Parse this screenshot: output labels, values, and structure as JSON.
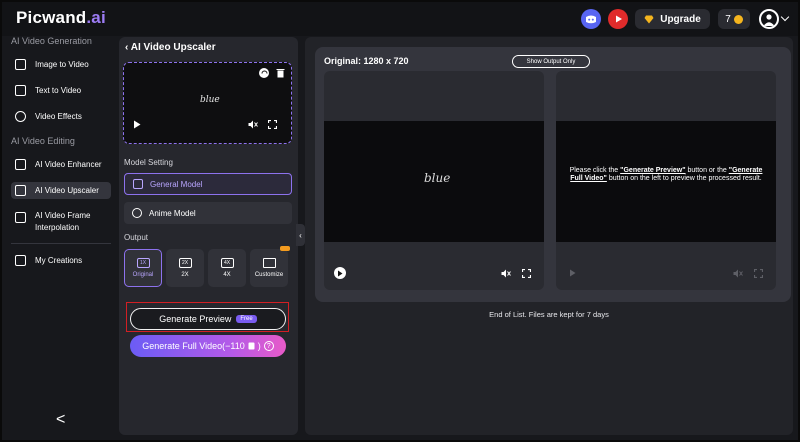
{
  "header": {
    "logo_text": "Picwand",
    "logo_suffix": ".ai",
    "upgrade_label": "Upgrade",
    "credits": "7",
    "icons": [
      "discord-icon",
      "youtube-icon",
      "diamond-icon",
      "coin-icon",
      "user-icon",
      "chevron-down-icon"
    ]
  },
  "sidebar": {
    "section1": "AI Video Generation",
    "section2": "AI Video Editing",
    "items": [
      {
        "label": "Image to Video",
        "icon": "image-icon"
      },
      {
        "label": "Text to Video",
        "icon": "text-icon"
      },
      {
        "label": "Video Effects",
        "icon": "effects-icon"
      },
      {
        "label": "AI Video Enhancer",
        "icon": "enhancer-icon"
      },
      {
        "label": "AI Video Upscaler",
        "icon": "upscaler-icon"
      },
      {
        "label": "AI Video Frame Interpolation",
        "icon": "interpolation-icon"
      },
      {
        "label": "My Creations",
        "icon": "folder-icon"
      }
    ],
    "active": "AI Video Upscaler",
    "collapse_glyph": "<"
  },
  "panel": {
    "title": "AI Video Upscaler",
    "thumb_text": "blue",
    "model_setting_label": "Model Setting",
    "models": [
      "General Model",
      "Anime Model"
    ],
    "selected_model": "General Model",
    "output_label": "Output",
    "outputs": [
      {
        "icon_text": "1X",
        "label": "Original"
      },
      {
        "icon_text": "2X",
        "label": "2X"
      },
      {
        "icon_text": "4X",
        "label": "4X"
      },
      {
        "icon_text": "",
        "label": "Customize"
      }
    ],
    "selected_output": "Original",
    "generate_preview": "Generate Preview",
    "free_badge": "Free",
    "generate_full": "Generate Full Video(−110",
    "generate_full_suffix": ")"
  },
  "main": {
    "original_label": "Original: 1280 x 720",
    "show_output_button": "Show Output Only",
    "video_text": "blue",
    "message_pre": "Please click the ",
    "message_b1": "\"Generate Preview\"",
    "message_mid": " button or the ",
    "message_b2": "\"Generate Full Video\"",
    "message_post": " button on the left to preview the processed result.",
    "end_text": "End of List. Files are kept for 7 days"
  },
  "colors": {
    "accent": "#8d72ee",
    "highlight_box": "#d21f24",
    "discord": "#5865f2",
    "youtube": "#e02b2b",
    "coin": "#f5b51e"
  }
}
